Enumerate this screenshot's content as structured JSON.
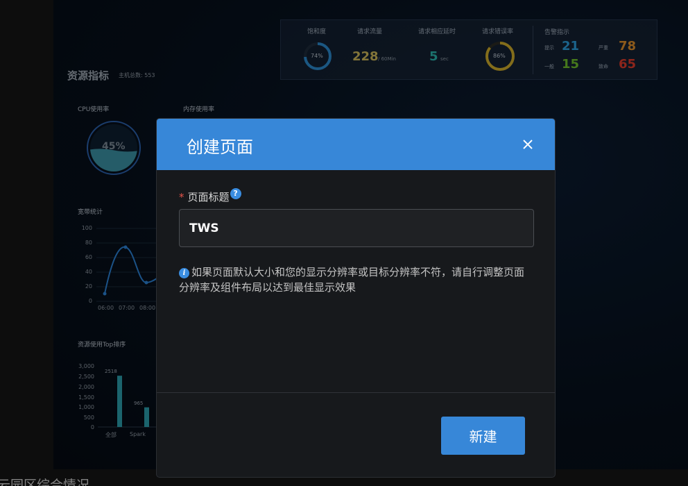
{
  "dashboard": {
    "metrics": {
      "saturation": {
        "label": "饱和度",
        "value_text": "74%",
        "fraction": 0.74,
        "color": "#2a86c8"
      },
      "request_flow": {
        "label": "请求流量",
        "value": "228",
        "unit": "/ 60Min",
        "color": "#c9b458"
      },
      "latency": {
        "label": "请求相应延时",
        "value": "5",
        "unit": "sec",
        "color": "#2ab0a8"
      },
      "error_rate": {
        "label": "请求错误率",
        "value_text": "86%",
        "fraction": 0.86,
        "color": "#c9a82a"
      },
      "alerts": {
        "label": "告警指示",
        "items": [
          {
            "name": "提示",
            "value": "21",
            "color": "#2a9ad8"
          },
          {
            "name": "严重",
            "value": "78",
            "color": "#d88a2a"
          },
          {
            "name": "一般",
            "value": "15",
            "color": "#6ab82a"
          },
          {
            "name": "致命",
            "value": "65",
            "color": "#d83a2a"
          }
        ]
      }
    },
    "resources": {
      "title": "资源指标",
      "host_count_label": "主机总数: 553",
      "cpu_label": "CPU使用率",
      "cpu_value_text": "45%",
      "cpu_fraction": 0.45,
      "mem_label": "内存使用率"
    },
    "bandwidth_chart": {
      "title": "宽带统计",
      "y_ticks": [
        "100",
        "80",
        "60",
        "40",
        "20",
        "0"
      ],
      "x_ticks": [
        "06:00",
        "07:00",
        "08:00"
      ]
    },
    "top_chart": {
      "title": "资源使用Top排序",
      "y_ticks": [
        "3,000",
        "2,500",
        "2,000",
        "1,500",
        "1,000",
        "500",
        "0"
      ],
      "bars": [
        {
          "category": "全部",
          "value": 2518,
          "label": "2518"
        },
        {
          "category": "Spark",
          "value": 965,
          "label": "965"
        }
      ]
    },
    "bottom_title": "云园区综合情况"
  },
  "modal": {
    "title": "创建页面",
    "field_label": "页面标题",
    "required_mark": "*",
    "help_glyph": "?",
    "input_value": "TWS",
    "info_glyph": "i",
    "info_text": "如果页面默认大小和您的显示分辨率或目标分辨率不符，请自行调整页面分辨率及组件布局以达到最佳显示效果",
    "create_button": "新建"
  },
  "colors": {
    "primary": "#3787d8",
    "modal_bg": "#17191c",
    "required": "#e5544a"
  }
}
